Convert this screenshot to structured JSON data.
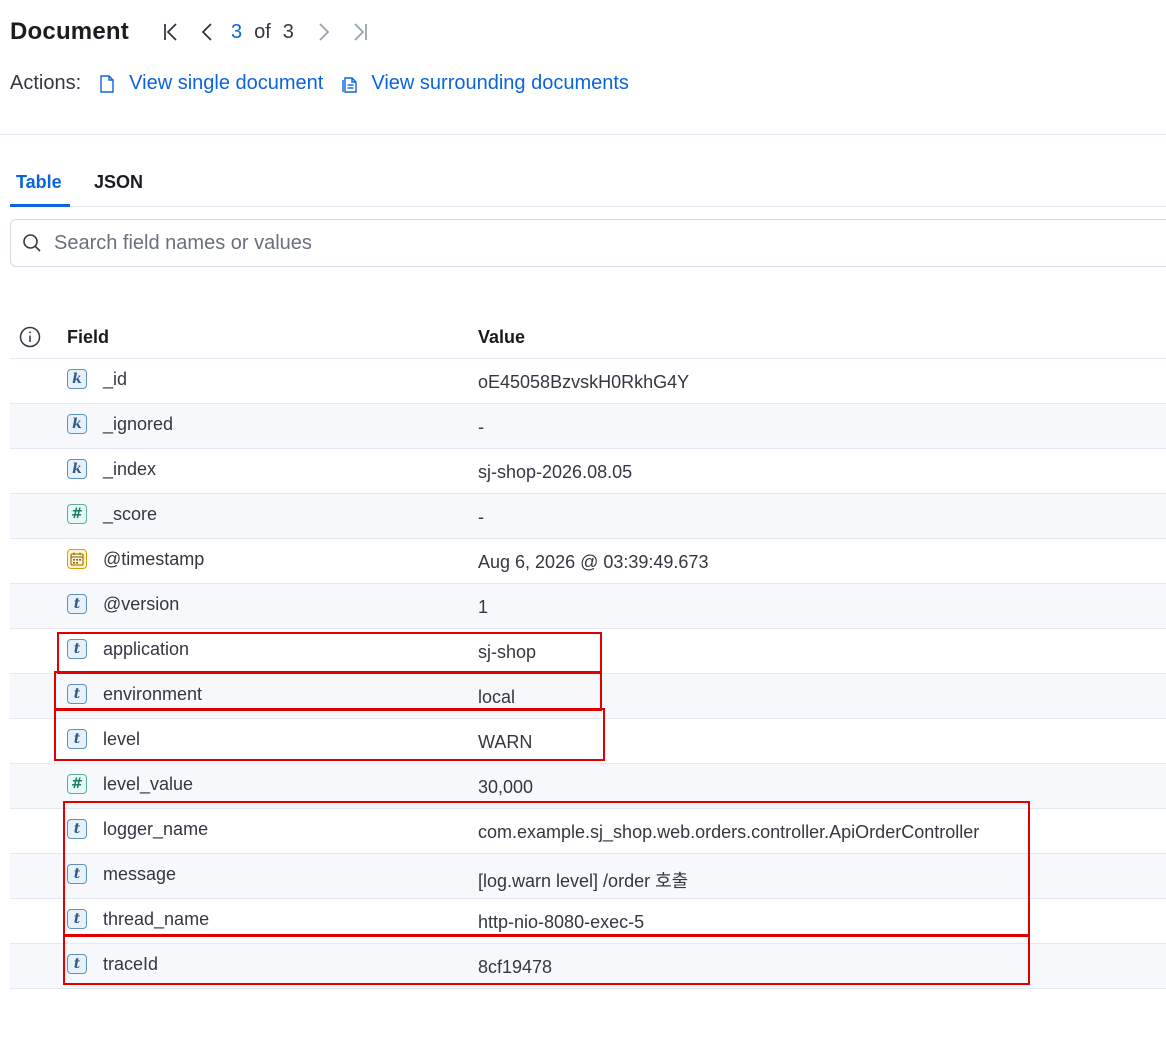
{
  "header": {
    "title": "Document",
    "pager": {
      "current": "3",
      "of_label": "of",
      "total": "3"
    }
  },
  "actions": {
    "label": "Actions:",
    "view_single": "View single document",
    "view_surrounding": "View surrounding documents"
  },
  "tabs": [
    {
      "label": "Table",
      "active": true
    },
    {
      "label": "JSON",
      "active": false
    }
  ],
  "search": {
    "placeholder": "Search field names or values"
  },
  "table": {
    "field_header": "Field",
    "value_header": "Value",
    "rows": [
      {
        "type": "k",
        "field": "_id",
        "value": "oE45058BzvskH0RkhG4Y"
      },
      {
        "type": "k",
        "field": "_ignored",
        "value": " -"
      },
      {
        "type": "k",
        "field": "_index",
        "value": "sj-shop-2026.08.05"
      },
      {
        "type": "#",
        "field": "_score",
        "value": " -"
      },
      {
        "type": "date",
        "field": "@timestamp",
        "value": "Aug 6, 2026 @ 03:39:49.673"
      },
      {
        "type": "t",
        "field": "@version",
        "value": "1"
      },
      {
        "type": "t",
        "field": "application",
        "value": "sj-shop"
      },
      {
        "type": "t",
        "field": "environment",
        "value": "local"
      },
      {
        "type": "t",
        "field": "level",
        "value": "WARN"
      },
      {
        "type": "#",
        "field": "level_value",
        "value": "30,000"
      },
      {
        "type": "t",
        "field": "logger_name",
        "value": "com.example.sj_shop.web.orders.controller.ApiOrderController"
      },
      {
        "type": "t",
        "field": "message",
        "value": "[log.warn level] /order 호출"
      },
      {
        "type": "t",
        "field": "thread_name",
        "value": "http-nio-8080-exec-5"
      },
      {
        "type": "t",
        "field": "traceId",
        "value": "8cf19478"
      }
    ]
  },
  "colors": {
    "accent": "#0b64dd",
    "highlight": "#e00000"
  }
}
